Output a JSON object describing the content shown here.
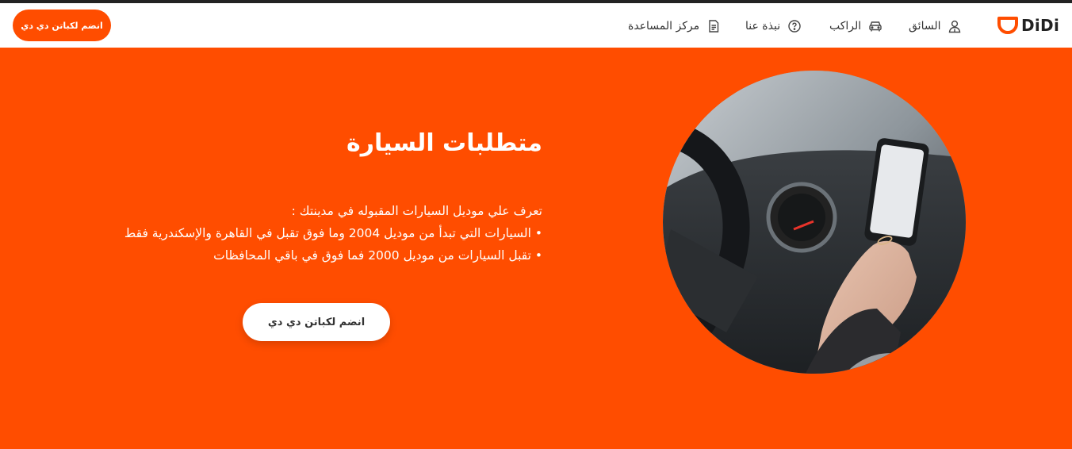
{
  "brand": {
    "name": "DiDi",
    "accent_color": "#ff4d00",
    "logo_icon": "didi-logo-icon"
  },
  "nav": {
    "items": [
      {
        "label": "السائق",
        "icon": "driver-icon"
      },
      {
        "label": "الراكب",
        "icon": "car-icon"
      },
      {
        "label": "نبذة عنا",
        "icon": "question-circle-icon"
      },
      {
        "label": "مركز المساعدة",
        "icon": "document-icon"
      }
    ],
    "cta_label": "انضم لكباتن دي دي"
  },
  "hero": {
    "title": "متطلبات السيارة",
    "intro": "تعرف علي موديل السيارات المقبوله في مدينتك :",
    "bullets": [
      "• السيارات التي تبدأ من موديل 2004 وما فوق تقبل في القاهرة والإسكندرية فقط",
      "• تقبل السيارات من موديل 2000 فما فوق في باقي المحافظات"
    ],
    "cta_label": "انضم لكباتن دي دي",
    "image": "driver-hand-on-phone-in-car"
  }
}
